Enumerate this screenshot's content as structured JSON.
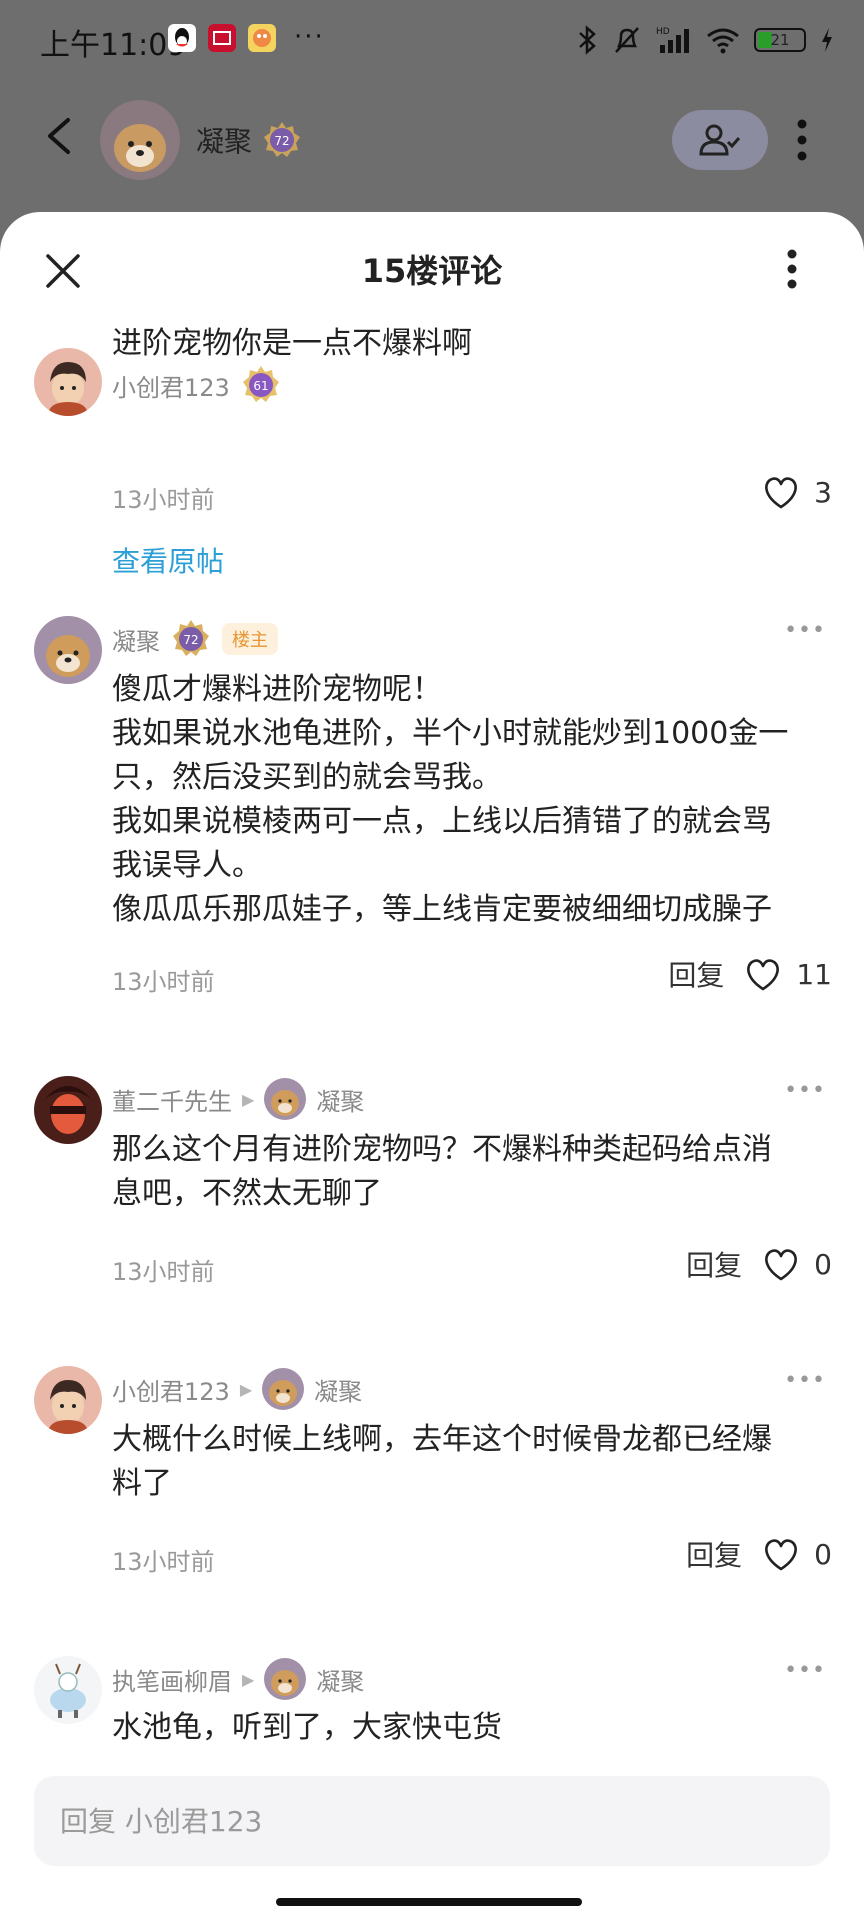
{
  "status_bar": {
    "time": "上午11:09",
    "more": "···",
    "battery": "21"
  },
  "header": {
    "name": "凝聚",
    "level": "72"
  },
  "sheet": {
    "title": "15楼评论"
  },
  "original_post": {
    "user": "小创君123",
    "level": "61",
    "text": "进阶宠物你是一点不爆料啊",
    "time": "13小时前",
    "likes": "3",
    "view_original": "查看原帖"
  },
  "comments": [
    {
      "user": "凝聚",
      "level": "72",
      "tag": "楼主",
      "lines": [
        "傻瓜才爆料进阶宠物呢！",
        "我如果说水池龟进阶，半个小时就能炒到1000金一",
        "只，然后没买到的就会骂我。",
        "我如果说模棱两可一点，上线以后猜错了的就会骂",
        "我误导人。",
        "像瓜瓜乐那瓜娃子，等上线肯定要被细细切成臊子"
      ],
      "time": "13小时前",
      "reply": "回复",
      "likes": "11"
    },
    {
      "user": "董二千先生",
      "reply_to": "凝聚",
      "lines": [
        "那么这个月有进阶宠物吗？不爆料种类起码给点消",
        "息吧，不然太无聊了"
      ],
      "time": "13小时前",
      "reply": "回复",
      "likes": "0"
    },
    {
      "user": "小创君123",
      "reply_to": "凝聚",
      "lines": [
        "大概什么时候上线啊，去年这个时候骨龙都已经爆",
        "料了"
      ],
      "time": "13小时前",
      "reply": "回复",
      "likes": "0"
    },
    {
      "user": "执笔画柳眉",
      "reply_to": "凝聚",
      "lines": [
        "水池龟，听到了，大家快屯货"
      ]
    }
  ],
  "reply_box": {
    "placeholder": "回复 小创君123"
  },
  "colors": {
    "link": "#2b9fd6",
    "owner_tag_bg": "#fdf0dc",
    "owner_tag_text": "#e89532",
    "overlay": "#6e6e6e"
  }
}
